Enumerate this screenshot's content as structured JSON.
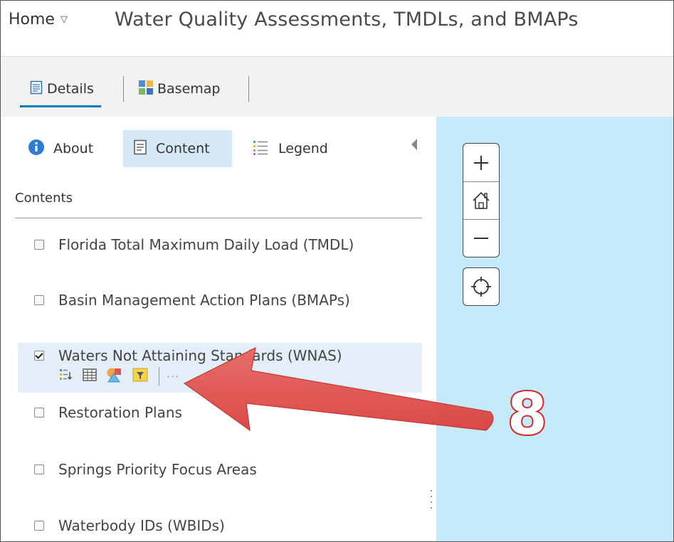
{
  "header": {
    "home_label": "Home",
    "home_caret": "▽",
    "title": "Water Quality Assessments, TMDLs, and BMAPs"
  },
  "tabs": [
    {
      "label": "Details",
      "icon": "details-doc-icon",
      "active": true
    },
    {
      "label": "Basemap",
      "icon": "basemap-grid-icon",
      "active": false
    }
  ],
  "pane": {
    "tabs": [
      {
        "label": "About",
        "icon": "info-icon"
      },
      {
        "label": "Content",
        "icon": "content-doc-icon",
        "active": true
      },
      {
        "label": "Legend",
        "icon": "legend-list-icon"
      }
    ],
    "contents_label": "Contents",
    "layers": [
      {
        "label": "Florida Total Maximum Daily Load (TMDL)",
        "checked": false
      },
      {
        "label": "Basin Management Action Plans (BMAPs)",
        "checked": false
      },
      {
        "label": "Waters Not Attaining Standards (WNAS)",
        "checked": true
      },
      {
        "label": "Restoration Plans",
        "checked": false
      },
      {
        "label": "Springs Priority Focus Areas",
        "checked": false
      },
      {
        "label": "Waterbody IDs (WBIDs)",
        "checked": false
      }
    ],
    "layer_tools": [
      "show-legend-icon",
      "attribute-table-icon",
      "change-style-icon",
      "filter-icon"
    ],
    "more_label": "···"
  },
  "map": {
    "controls": [
      "zoom-in-icon",
      "default-extent-home-icon",
      "zoom-out-icon",
      "locate-icon"
    ]
  },
  "annotation": {
    "step_number": "8",
    "color": "#e05552"
  }
}
